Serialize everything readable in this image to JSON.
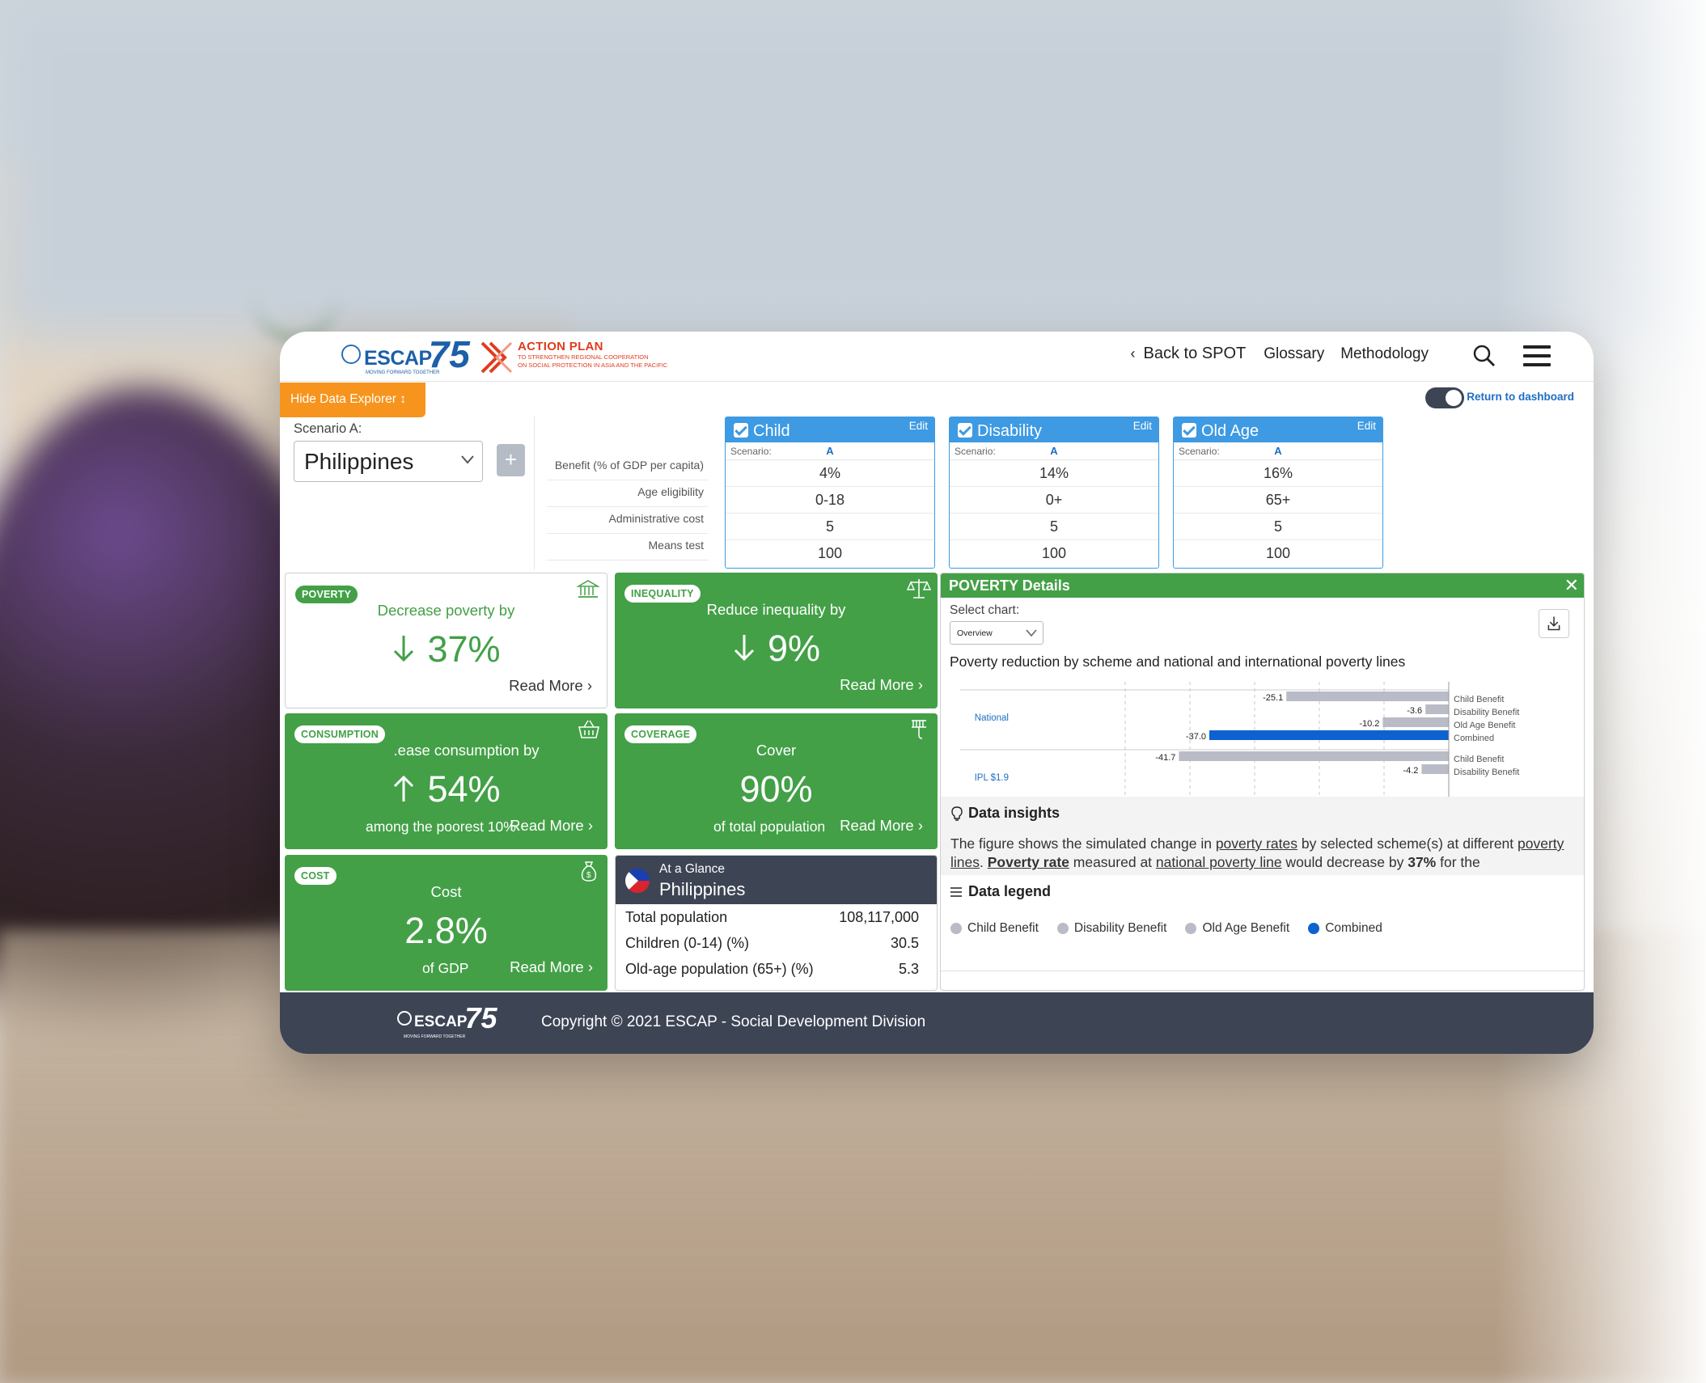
{
  "colors": {
    "green": "#43a047",
    "blue": "#3d9ae3",
    "orange": "#f7941d",
    "dark": "#3d4454",
    "combined": "#0d62cf",
    "gray_bar": "#b9bcc6"
  },
  "header": {
    "logo_escap": {
      "word": "ESCAP",
      "num": "75",
      "tagline": "MOVING FORWARD TOGETHER"
    },
    "logo_action": {
      "title": "ACTION PLAN",
      "line1": "TO STRENGTHEN REGIONAL COOPERATION",
      "line2": "ON SOCIAL PROTECTION IN ASIA AND THE PACIFIC"
    },
    "nav": {
      "back": "Back to SPOT",
      "glossary": "Glossary",
      "methodology": "Methodology"
    },
    "icons": {
      "search": "search-icon",
      "menu": "hamburger-menu-icon"
    }
  },
  "explorer": {
    "hide_label": "Hide Data Explorer ↕",
    "return_label": "Return to dashboard",
    "scenario_label": "Scenario A:",
    "country": "Philippines",
    "add": "+",
    "param_labels": [
      "Benefit (% of GDP per capita)",
      "Age eligibility",
      "Administrative cost",
      "Means test"
    ],
    "schemes": [
      {
        "name": "Child",
        "edit": "Edit",
        "scenario": "Scenario:",
        "col": "A",
        "values": [
          "4%",
          "0-18",
          "5",
          "100"
        ]
      },
      {
        "name": "Disability",
        "edit": "Edit",
        "scenario": "Scenario:",
        "col": "A",
        "values": [
          "14%",
          "0+",
          "5",
          "100"
        ]
      },
      {
        "name": "Old Age",
        "edit": "Edit",
        "scenario": "Scenario:",
        "col": "A",
        "values": [
          "16%",
          "65+",
          "5",
          "100"
        ]
      }
    ]
  },
  "cards": {
    "poverty": {
      "badge": "POVERTY",
      "heading": "Decrease poverty by",
      "value": "37%",
      "more": "Read More ›"
    },
    "inequality": {
      "badge": "INEQUALITY",
      "heading": "Reduce inequality by",
      "value": "9%",
      "more": "Read More ›"
    },
    "consumption": {
      "badge": "CONSUMPTION",
      "heading": ".ease consumption by",
      "value": "54%",
      "sub": "among the poorest 10%",
      "more": "Read More ›"
    },
    "coverage": {
      "badge": "COVERAGE",
      "heading": "Cover",
      "value": "90%",
      "sub": "of total population",
      "more": "Read More ›"
    },
    "cost": {
      "badge": "COST",
      "heading": "Cost",
      "value": "2.8%",
      "sub": "of GDP",
      "more": "Read More ›"
    }
  },
  "glance": {
    "title": "At a Glance",
    "country": "Philippines",
    "rows": [
      {
        "label": "Total population",
        "value": "108,117,000"
      },
      {
        "label": "Children (0-14) (%)",
        "value": "30.5"
      },
      {
        "label": "Old-age population (65+) (%)",
        "value": "5.3"
      }
    ]
  },
  "details": {
    "title": "POVERTY Details",
    "close": "✕",
    "select_label": "Select chart:",
    "select_value": "Overview",
    "chart_title": "Poverty reduction by scheme and national and international poverty lines",
    "insights_title": "Data insights",
    "insights_text_1": "The figure shows the simulated change in ",
    "insights_link_1": "poverty rates",
    "insights_text_2": " by selected scheme(s) at different ",
    "insights_link_2": "poverty lines",
    "insights_text_3": ". ",
    "insights_bold_1": "Poverty rate",
    "insights_text_4": " measured at ",
    "insights_link_3": "national poverty line",
    "insights_text_5": " would decrease by ",
    "insights_bold_2": "37%",
    "insights_text_6": " for the",
    "legend_title": "Data legend",
    "legend": [
      {
        "label": "Child Benefit",
        "color": "#b9bcc6"
      },
      {
        "label": "Disability Benefit",
        "color": "#b9bcc6"
      },
      {
        "label": "Old Age Benefit",
        "color": "#b9bcc6"
      },
      {
        "label": "Combined",
        "color": "#0d62cf"
      }
    ]
  },
  "chart_data": {
    "type": "bar",
    "orientation": "horizontal",
    "title": "Poverty reduction by scheme and national and international poverty lines",
    "groups": [
      {
        "name": "National",
        "bars": [
          {
            "label": "Child Benefit",
            "value": -25.1
          },
          {
            "label": "Disability Benefit",
            "value": -3.6
          },
          {
            "label": "Old Age Benefit",
            "value": -10.2
          },
          {
            "label": "Combined",
            "value": -37.0
          }
        ]
      },
      {
        "name": "IPL $1.9",
        "bars": [
          {
            "label": "Child Benefit",
            "value": -41.7
          },
          {
            "label": "Disability Benefit",
            "value": -4.2
          }
        ]
      }
    ],
    "xlim": [
      -50,
      0
    ],
    "grid": true
  },
  "footer": {
    "logo": {
      "word": "ESCAP",
      "num": "75",
      "tagline": "MOVING FORWARD TOGETHER"
    },
    "copyright": "Copyright © 2021 ESCAP - Social Development Division"
  }
}
